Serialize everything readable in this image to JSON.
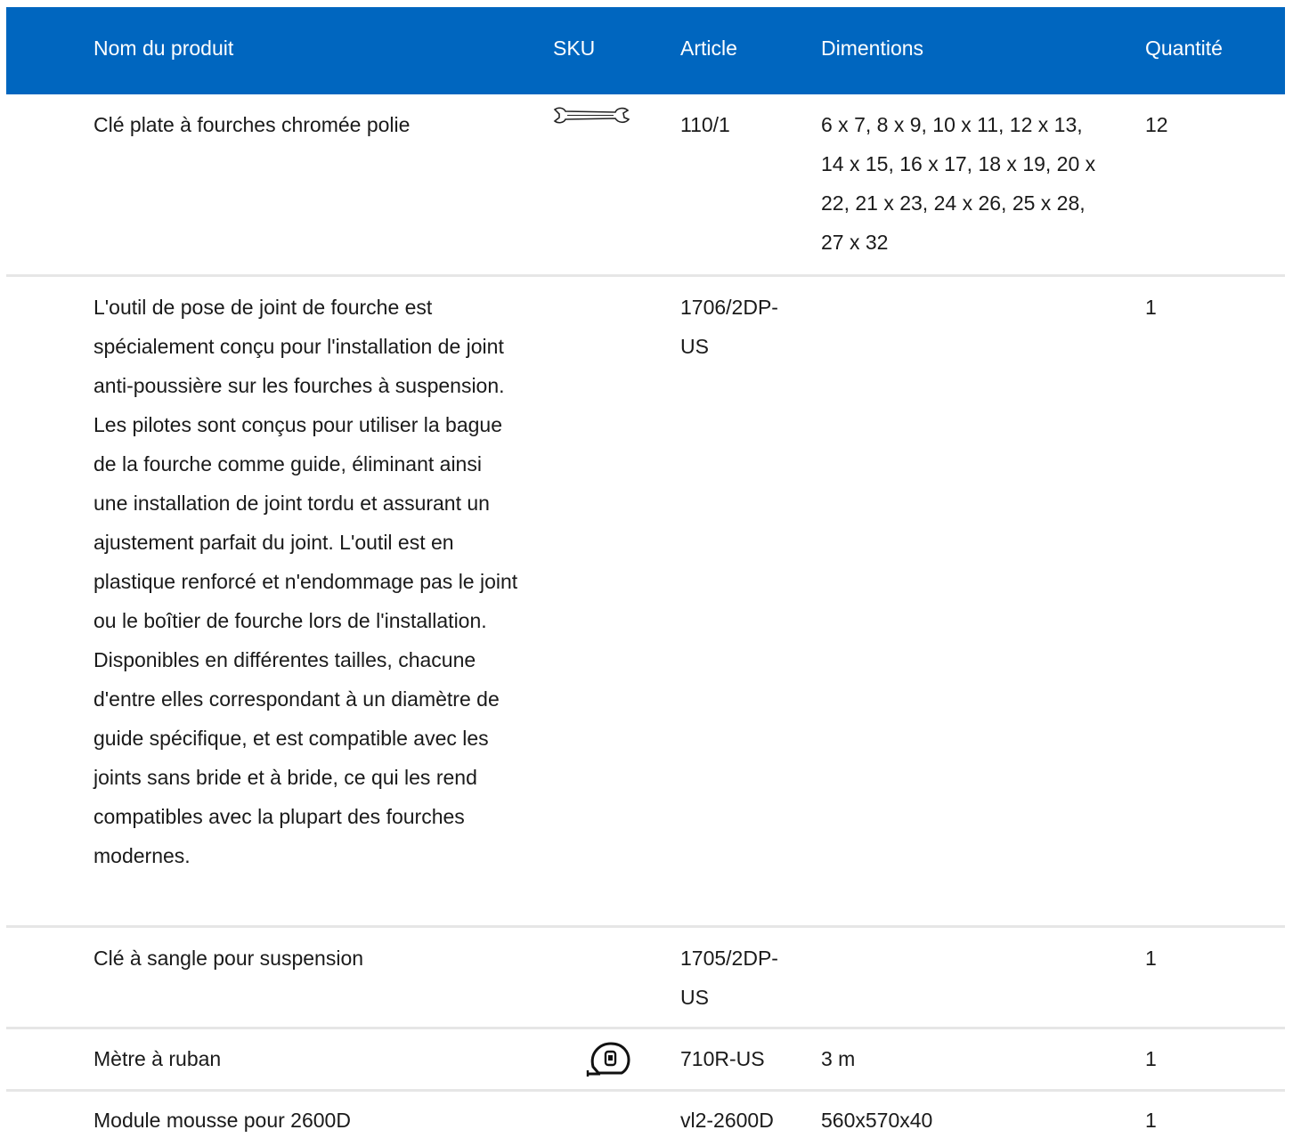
{
  "header": {
    "name": "Nom du produit",
    "sku": "SKU",
    "article": "Article",
    "dimensions": "Dimentions",
    "quantity": "Quantité"
  },
  "rows": [
    {
      "name": "Clé plate à fourches chromée polie",
      "sku_icon": "wrench-icon",
      "article": "110/1",
      "dimensions": "6 x 7, 8 x 9, 10 x 11, 12 x 13, 14 x 15, 16 x 17, 18 x 19, 20 x 22, 21 x 23, 24 x 26, 25 x 28, 27 x 32",
      "quantity": "12"
    },
    {
      "name": "L'outil de pose de joint de fourche est spécialement conçu pour l'installation de joint anti-poussière sur les fourches à suspension. Les pilotes sont conçus pour utiliser la bague de la fourche comme guide, éliminant ainsi une installation de joint tordu et assurant un ajustement parfait du joint. L'outil est en plastique renforcé et n'endommage pas le joint ou le boîtier de fourche lors de l'installation. Disponibles en différentes tailles, chacune d'entre elles correspondant à un diamètre de guide spécifique, et est compatible avec les joints sans bride et à bride, ce qui les rend compatibles avec la plupart des fourches modernes.",
      "article": "1706/2DP-US",
      "dimensions": "",
      "quantity": "1"
    },
    {
      "name": "Clé à sangle pour suspension",
      "article": "1705/2DP-US",
      "dimensions": "",
      "quantity": "1"
    },
    {
      "name": "Mètre à ruban",
      "sku_icon": "tape-measure-icon",
      "article": "710R-US",
      "dimensions": "3 m",
      "quantity": "1"
    },
    {
      "name": "Module mousse pour 2600D",
      "article": "vl2-2600D",
      "dimensions": "560x570x40",
      "quantity": "1"
    }
  ]
}
